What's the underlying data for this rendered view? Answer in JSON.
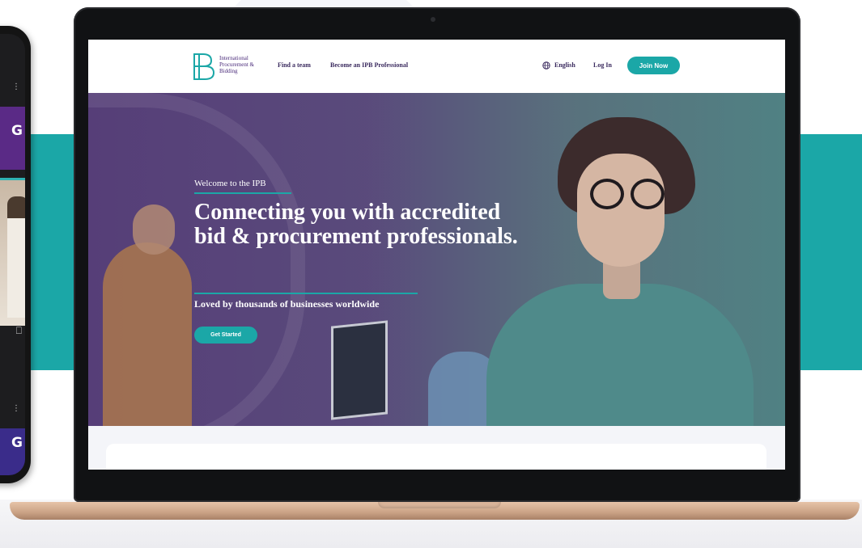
{
  "site": {
    "logo_text": "International Procurement & Bidding"
  },
  "nav": {
    "find_team": "Find a team",
    "become_pro": "Become an IPB Professional",
    "language": "English",
    "login": "Log In",
    "join": "Join Now"
  },
  "hero": {
    "eyebrow": "Welcome to the IPB",
    "heading": "Connecting you with accredited bid & procurement professionals.",
    "subheading": "Loved by thousands of businesses worldwide",
    "cta": "Get Started"
  },
  "colors": {
    "accent": "#1ba7a7",
    "brand_purple": "#4a2b7a"
  }
}
